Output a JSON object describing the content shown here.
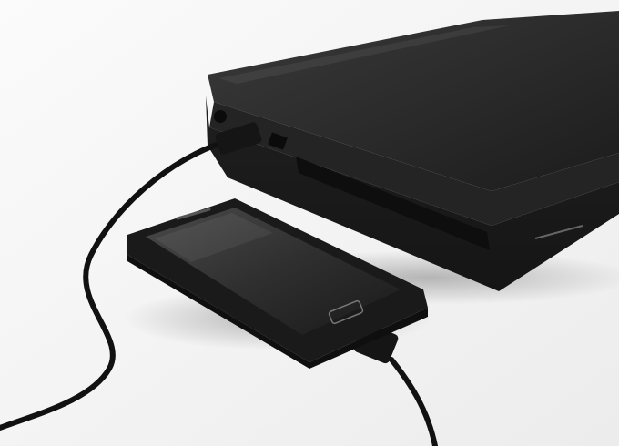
{
  "scene": {
    "objects": [
      "laptop",
      "smartphone",
      "usb-cable"
    ],
    "colors": {
      "background": "#f2f2f2",
      "laptop_body": "#2b2b2b",
      "phone_body": "#1e1e1e",
      "phone_screen": "#3a3a3a",
      "cable": "#111111"
    }
  }
}
